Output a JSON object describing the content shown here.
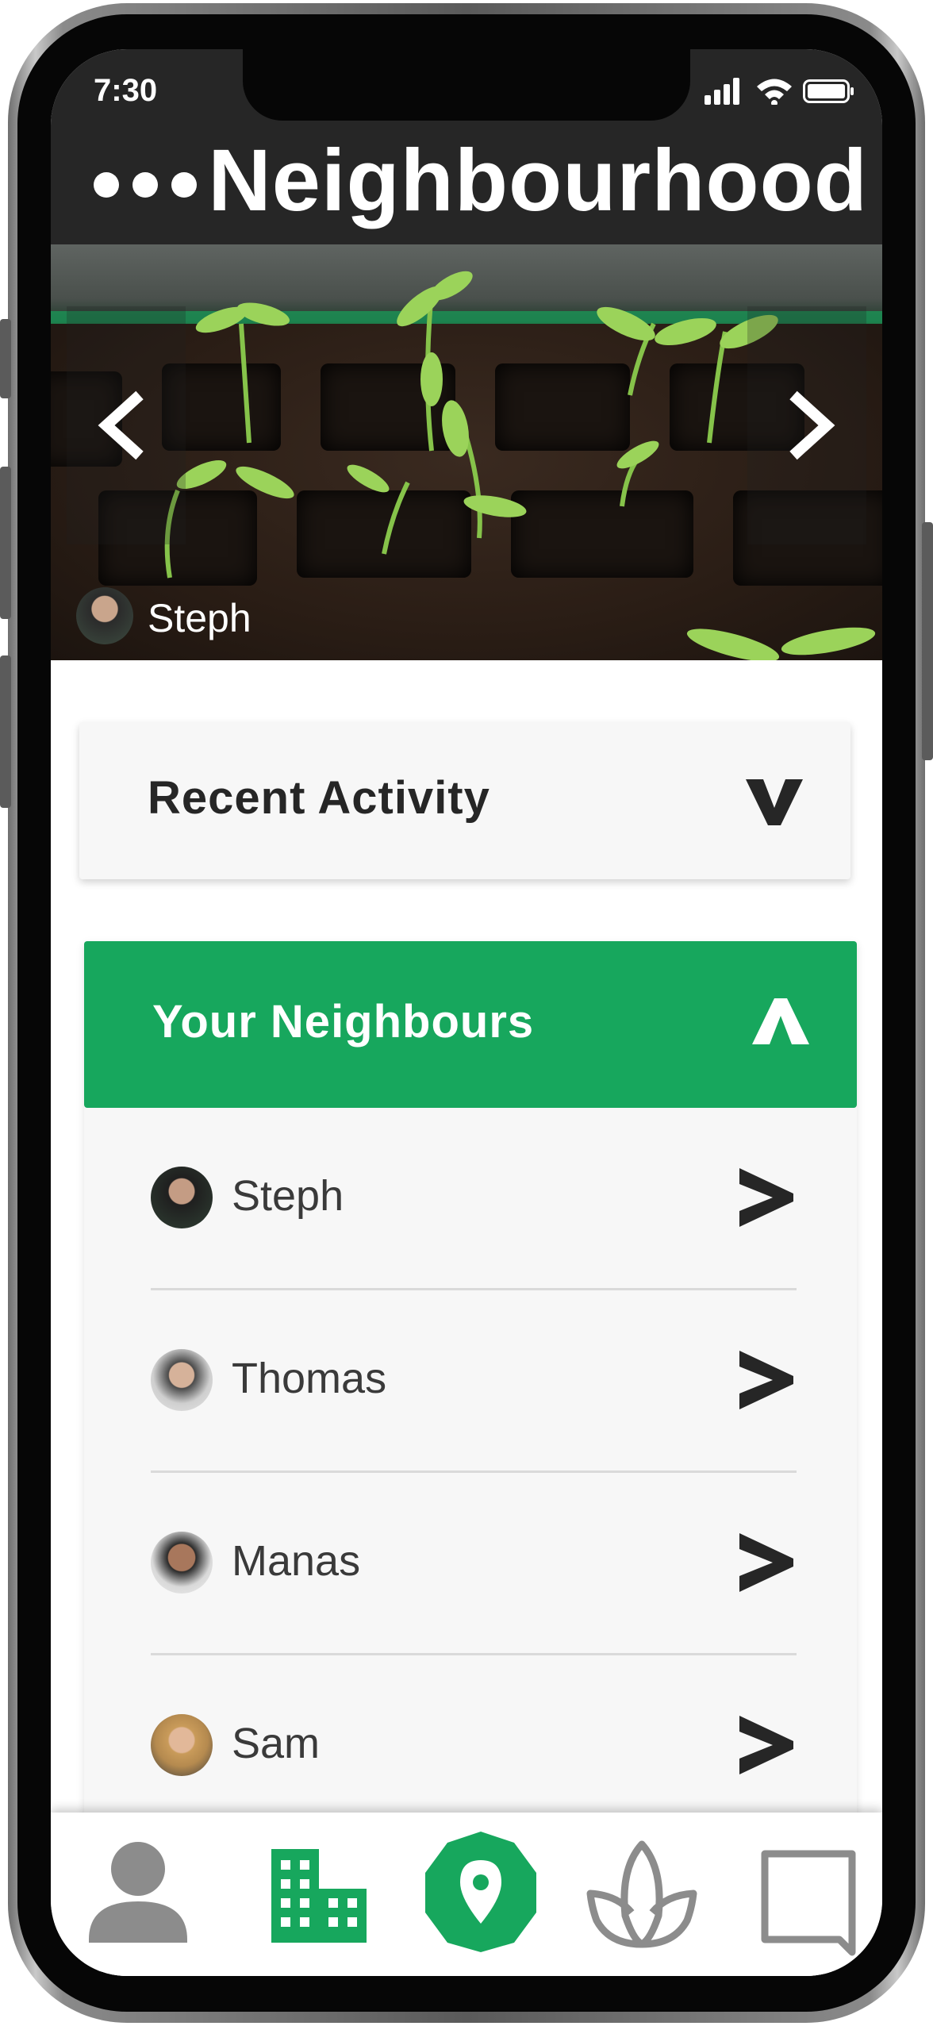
{
  "status_bar": {
    "time": "7:30"
  },
  "header": {
    "title": "Neighbourhood",
    "menu_icon": "more-dots-icon"
  },
  "hero": {
    "user_name": "Steph",
    "prev_icon": "chevron-left-icon",
    "next_icon": "chevron-right-icon"
  },
  "recent_activity": {
    "label": "Recent Activity",
    "icon": "chevron-down-icon"
  },
  "neighbours": {
    "label": "Your Neighbours",
    "icon": "chevron-up-icon",
    "items": [
      {
        "name": "Steph"
      },
      {
        "name": "Thomas"
      },
      {
        "name": "Manas"
      },
      {
        "name": "Sam"
      }
    ]
  },
  "tabbar": {
    "tabs": [
      {
        "icon": "person-icon",
        "active": false
      },
      {
        "icon": "building-icon",
        "active": false
      },
      {
        "icon": "map-pin-icon",
        "active": true
      },
      {
        "icon": "lotus-icon",
        "active": false
      },
      {
        "icon": "chat-bubble-icon",
        "active": false
      }
    ]
  },
  "colors": {
    "accent": "#17a75d",
    "header_bg": "#262626",
    "text_dark": "#262626",
    "icon_inactive": "#8c8c8c"
  }
}
